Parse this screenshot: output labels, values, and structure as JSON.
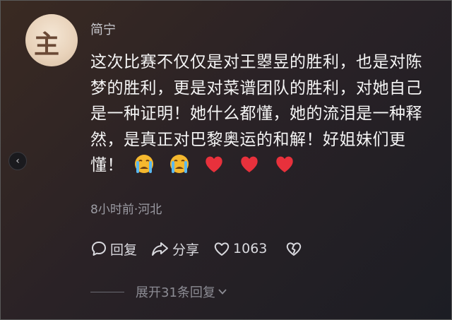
{
  "comment": {
    "username": "简宁",
    "text_before_emoji": "这次比赛不仅仅是对王曌昱的胜利，也是对陈梦的胜利，更是对菜谱团队的胜利，对她自己是一种证明！她什么都懂，她的流泪是一种释然，是真正对巴黎奥运的和解！好姐妹们更懂！",
    "emojis": [
      "crying-face",
      "crying-face",
      "red-heart",
      "red-heart",
      "red-heart"
    ],
    "meta": "8小时前·河北"
  },
  "actions": {
    "reply_label": "回复",
    "share_label": "分享",
    "like_count": "1063"
  },
  "expand": {
    "label": "展开31条回复"
  },
  "colors": {
    "heart_red": "#e8313c",
    "crying_yellow": "#f5b82e",
    "tear_blue": "#5ab8f0"
  }
}
